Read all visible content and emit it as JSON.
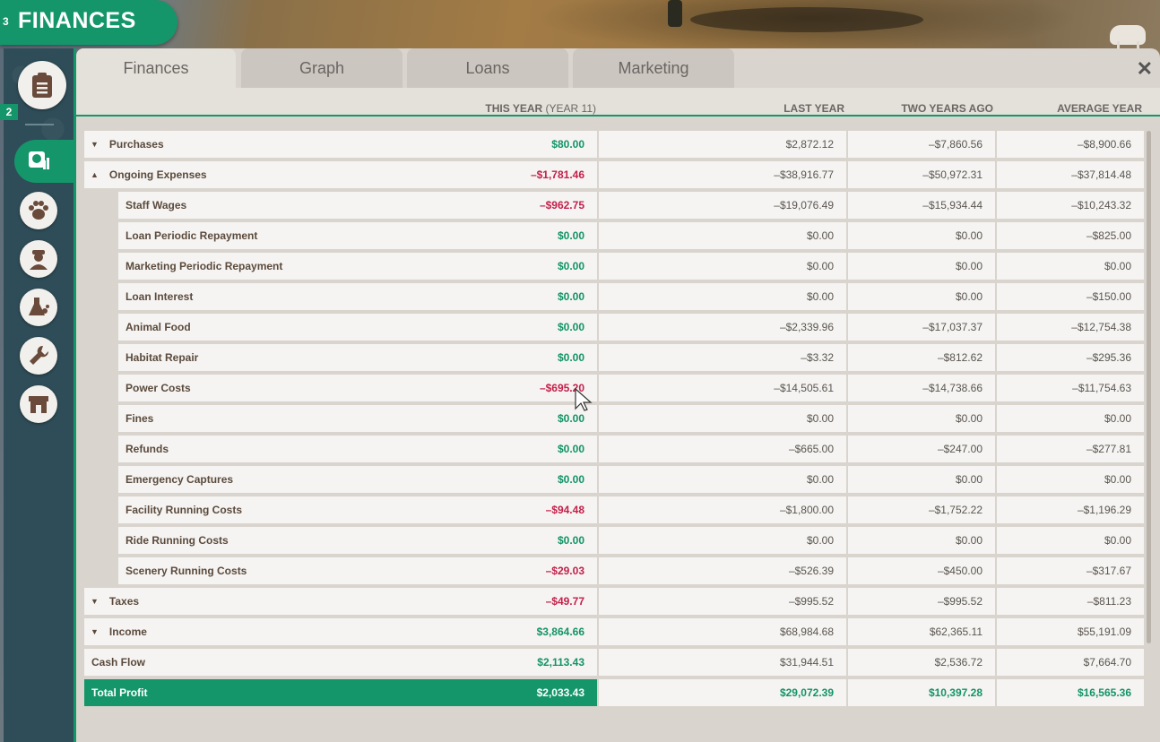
{
  "title": {
    "text": "FINANCES",
    "count": "3"
  },
  "sidebar": {
    "count": "2",
    "items": [
      {
        "name": "clipboard",
        "icon": "clipboard-icon"
      },
      {
        "name": "finances",
        "icon": "money-icon",
        "active": true
      },
      {
        "name": "animals",
        "icon": "paw-icon"
      },
      {
        "name": "staff",
        "icon": "staff-icon"
      },
      {
        "name": "research",
        "icon": "research-icon"
      },
      {
        "name": "maintenance",
        "icon": "wrench-icon"
      },
      {
        "name": "shops",
        "icon": "shop-icon"
      }
    ]
  },
  "tabs": [
    {
      "label": "Finances",
      "active": true
    },
    {
      "label": "Graph"
    },
    {
      "label": "Loans"
    },
    {
      "label": "Marketing"
    }
  ],
  "close_label": "✕",
  "columns": {
    "this_year": "THIS YEAR",
    "this_year_sub": "(YEAR 11)",
    "last_year": "LAST YEAR",
    "two_years_ago": "TWO YEARS AGO",
    "average_year": "AVERAGE YEAR"
  },
  "rows": [
    {
      "label": "Purchases",
      "caret": "▼",
      "indent": 0,
      "this": "$80.00",
      "this_sign": "pos",
      "last": "$2,872.12",
      "two": "–$7,860.56",
      "avg": "–$8,900.66"
    },
    {
      "label": "Ongoing Expenses",
      "caret": "▲",
      "indent": 0,
      "this": "–$1,781.46",
      "this_sign": "neg",
      "last": "–$38,916.77",
      "two": "–$50,972.31",
      "avg": "–$37,814.48"
    },
    {
      "label": "Staff Wages",
      "indent": 1,
      "this": "–$962.75",
      "this_sign": "neg",
      "last": "–$19,076.49",
      "two": "–$15,934.44",
      "avg": "–$10,243.32"
    },
    {
      "label": "Loan Periodic Repayment",
      "indent": 1,
      "this": "$0.00",
      "this_sign": "pos",
      "last": "$0.00",
      "two": "$0.00",
      "avg": "–$825.00"
    },
    {
      "label": "Marketing Periodic Repayment",
      "indent": 1,
      "this": "$0.00",
      "this_sign": "pos",
      "last": "$0.00",
      "two": "$0.00",
      "avg": "$0.00"
    },
    {
      "label": "Loan Interest",
      "indent": 1,
      "this": "$0.00",
      "this_sign": "pos",
      "last": "$0.00",
      "two": "$0.00",
      "avg": "–$150.00"
    },
    {
      "label": "Animal Food",
      "indent": 1,
      "this": "$0.00",
      "this_sign": "pos",
      "last": "–$2,339.96",
      "two": "–$17,037.37",
      "avg": "–$12,754.38"
    },
    {
      "label": "Habitat Repair",
      "indent": 1,
      "this": "$0.00",
      "this_sign": "pos",
      "last": "–$3.32",
      "two": "–$812.62",
      "avg": "–$295.36"
    },
    {
      "label": "Power Costs",
      "indent": 1,
      "this": "–$695.20",
      "this_sign": "neg",
      "last": "–$14,505.61",
      "two": "–$14,738.66",
      "avg": "–$11,754.63"
    },
    {
      "label": "Fines",
      "indent": 1,
      "this": "$0.00",
      "this_sign": "pos",
      "last": "$0.00",
      "two": "$0.00",
      "avg": "$0.00"
    },
    {
      "label": "Refunds",
      "indent": 1,
      "this": "$0.00",
      "this_sign": "pos",
      "last": "–$665.00",
      "two": "–$247.00",
      "avg": "–$277.81"
    },
    {
      "label": "Emergency Captures",
      "indent": 1,
      "this": "$0.00",
      "this_sign": "pos",
      "last": "$0.00",
      "two": "$0.00",
      "avg": "$0.00"
    },
    {
      "label": "Facility Running Costs",
      "indent": 1,
      "this": "–$94.48",
      "this_sign": "neg",
      "last": "–$1,800.00",
      "two": "–$1,752.22",
      "avg": "–$1,196.29"
    },
    {
      "label": "Ride Running Costs",
      "indent": 1,
      "this": "$0.00",
      "this_sign": "pos",
      "last": "$0.00",
      "two": "$0.00",
      "avg": "$0.00"
    },
    {
      "label": "Scenery Running Costs",
      "indent": 1,
      "this": "–$29.03",
      "this_sign": "neg",
      "last": "–$526.39",
      "two": "–$450.00",
      "avg": "–$317.67"
    },
    {
      "label": "Taxes",
      "caret": "▼",
      "indent": 0,
      "this": "–$49.77",
      "this_sign": "neg",
      "last": "–$995.52",
      "two": "–$995.52",
      "avg": "–$811.23"
    },
    {
      "label": "Income",
      "caret": "▼",
      "indent": 0,
      "this": "$3,864.66",
      "this_sign": "pos",
      "last": "$68,984.68",
      "two": "$62,365.11",
      "avg": "$55,191.09"
    },
    {
      "label": "Cash Flow",
      "indent": 0,
      "this": "$2,113.43",
      "this_sign": "pos",
      "last": "$31,944.51",
      "two": "$2,536.72",
      "avg": "$7,664.70"
    },
    {
      "label": "Total Profit",
      "indent": 0,
      "total": true,
      "this": "$2,033.43",
      "this_sign": "pos",
      "last": "$29,072.39",
      "two": "$10,397.28",
      "avg": "$16,565.36"
    }
  ],
  "colors": {
    "accent": "#14966a",
    "positive": "#129466",
    "negative": "#c4204a"
  }
}
